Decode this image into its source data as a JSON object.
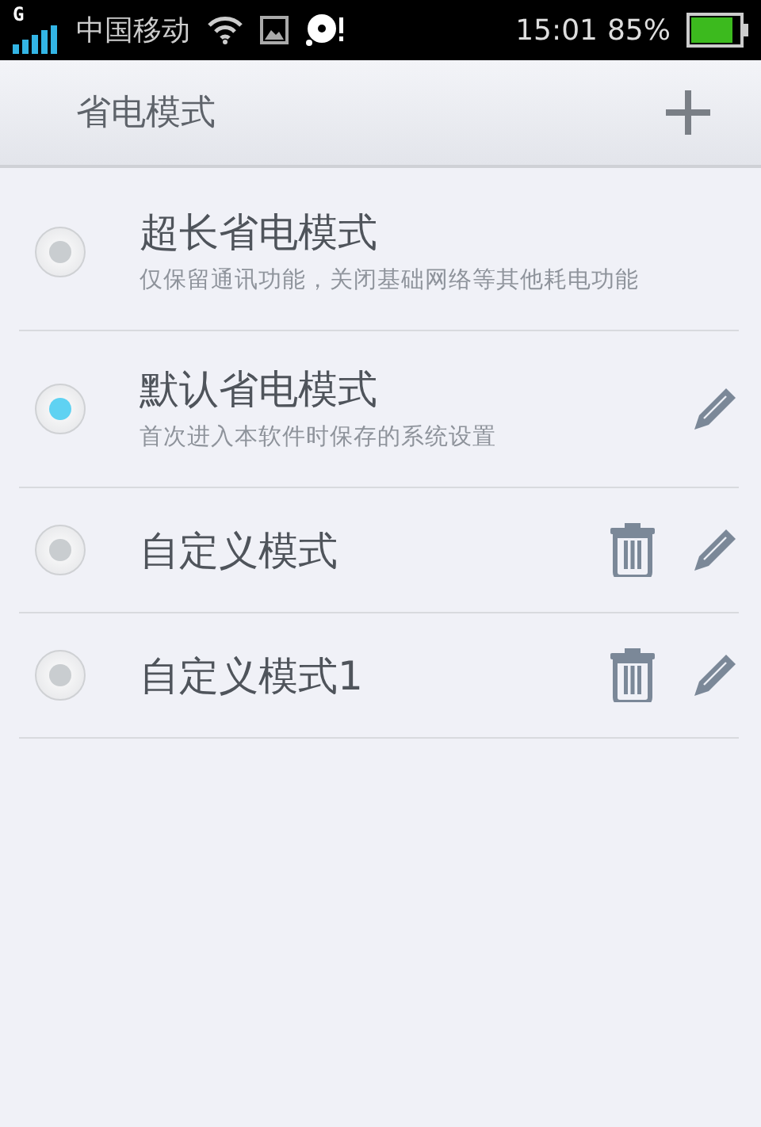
{
  "status_bar": {
    "network": "G",
    "carrier": "中国移动",
    "time": "15:01",
    "battery": "85%"
  },
  "header": {
    "title": "省电模式"
  },
  "modes": [
    {
      "title": "超长省电模式",
      "subtitle": "仅保留通讯功能，关闭基础网络等其他耗电功能",
      "selected": false,
      "deletable": false,
      "editable": false
    },
    {
      "title": "默认省电模式",
      "subtitle": "首次进入本软件时保存的系统设置",
      "selected": true,
      "deletable": false,
      "editable": true
    },
    {
      "title": "自定义模式",
      "selected": false,
      "deletable": true,
      "editable": true
    },
    {
      "title": "自定义模式1",
      "selected": false,
      "deletable": true,
      "editable": true
    }
  ]
}
